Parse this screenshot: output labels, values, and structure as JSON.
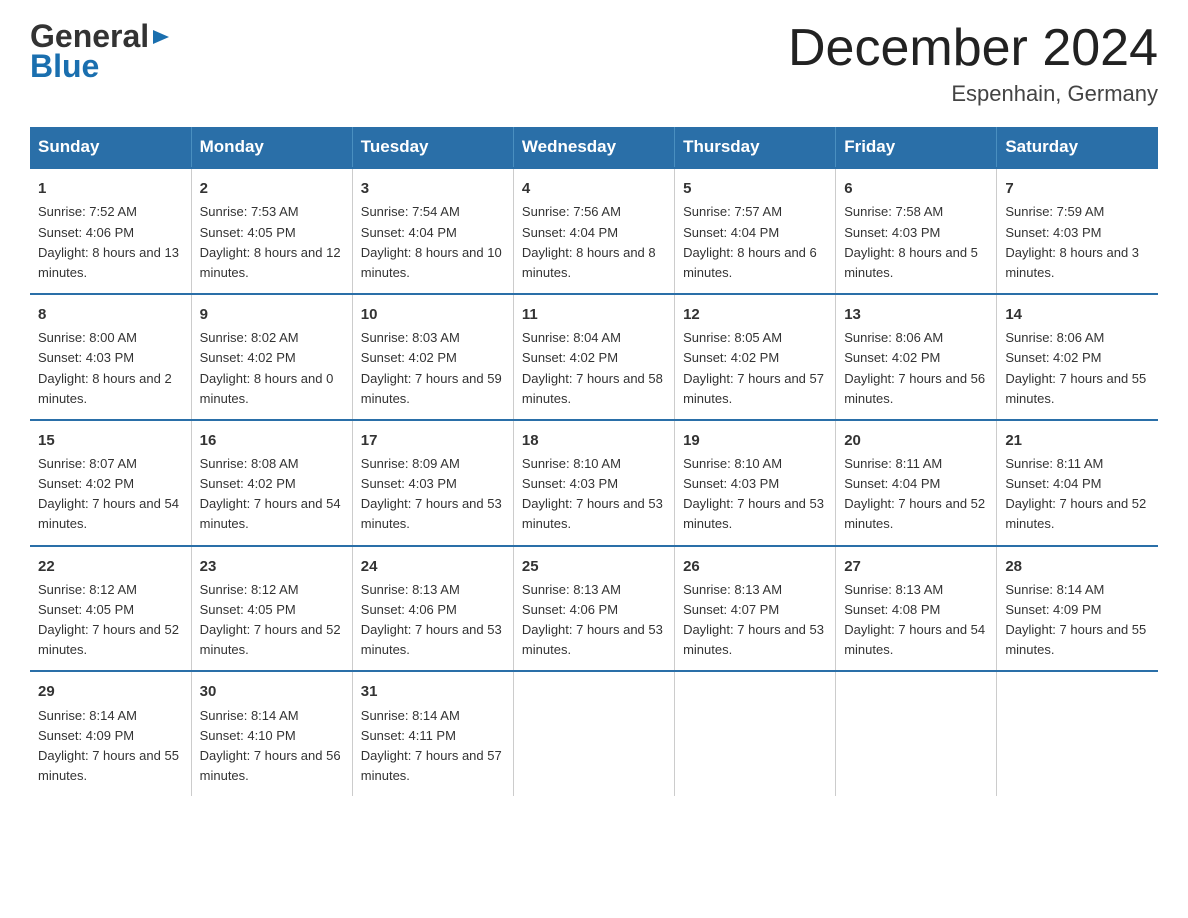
{
  "header": {
    "logo_general": "General",
    "logo_blue": "Blue",
    "month_title": "December 2024",
    "location": "Espenhain, Germany"
  },
  "days_of_week": [
    "Sunday",
    "Monday",
    "Tuesday",
    "Wednesday",
    "Thursday",
    "Friday",
    "Saturday"
  ],
  "weeks": [
    [
      {
        "num": "1",
        "sunrise": "7:52 AM",
        "sunset": "4:06 PM",
        "daylight": "8 hours and 13 minutes."
      },
      {
        "num": "2",
        "sunrise": "7:53 AM",
        "sunset": "4:05 PM",
        "daylight": "8 hours and 12 minutes."
      },
      {
        "num": "3",
        "sunrise": "7:54 AM",
        "sunset": "4:04 PM",
        "daylight": "8 hours and 10 minutes."
      },
      {
        "num": "4",
        "sunrise": "7:56 AM",
        "sunset": "4:04 PM",
        "daylight": "8 hours and 8 minutes."
      },
      {
        "num": "5",
        "sunrise": "7:57 AM",
        "sunset": "4:04 PM",
        "daylight": "8 hours and 6 minutes."
      },
      {
        "num": "6",
        "sunrise": "7:58 AM",
        "sunset": "4:03 PM",
        "daylight": "8 hours and 5 minutes."
      },
      {
        "num": "7",
        "sunrise": "7:59 AM",
        "sunset": "4:03 PM",
        "daylight": "8 hours and 3 minutes."
      }
    ],
    [
      {
        "num": "8",
        "sunrise": "8:00 AM",
        "sunset": "4:03 PM",
        "daylight": "8 hours and 2 minutes."
      },
      {
        "num": "9",
        "sunrise": "8:02 AM",
        "sunset": "4:02 PM",
        "daylight": "8 hours and 0 minutes."
      },
      {
        "num": "10",
        "sunrise": "8:03 AM",
        "sunset": "4:02 PM",
        "daylight": "7 hours and 59 minutes."
      },
      {
        "num": "11",
        "sunrise": "8:04 AM",
        "sunset": "4:02 PM",
        "daylight": "7 hours and 58 minutes."
      },
      {
        "num": "12",
        "sunrise": "8:05 AM",
        "sunset": "4:02 PM",
        "daylight": "7 hours and 57 minutes."
      },
      {
        "num": "13",
        "sunrise": "8:06 AM",
        "sunset": "4:02 PM",
        "daylight": "7 hours and 56 minutes."
      },
      {
        "num": "14",
        "sunrise": "8:06 AM",
        "sunset": "4:02 PM",
        "daylight": "7 hours and 55 minutes."
      }
    ],
    [
      {
        "num": "15",
        "sunrise": "8:07 AM",
        "sunset": "4:02 PM",
        "daylight": "7 hours and 54 minutes."
      },
      {
        "num": "16",
        "sunrise": "8:08 AM",
        "sunset": "4:02 PM",
        "daylight": "7 hours and 54 minutes."
      },
      {
        "num": "17",
        "sunrise": "8:09 AM",
        "sunset": "4:03 PM",
        "daylight": "7 hours and 53 minutes."
      },
      {
        "num": "18",
        "sunrise": "8:10 AM",
        "sunset": "4:03 PM",
        "daylight": "7 hours and 53 minutes."
      },
      {
        "num": "19",
        "sunrise": "8:10 AM",
        "sunset": "4:03 PM",
        "daylight": "7 hours and 53 minutes."
      },
      {
        "num": "20",
        "sunrise": "8:11 AM",
        "sunset": "4:04 PM",
        "daylight": "7 hours and 52 minutes."
      },
      {
        "num": "21",
        "sunrise": "8:11 AM",
        "sunset": "4:04 PM",
        "daylight": "7 hours and 52 minutes."
      }
    ],
    [
      {
        "num": "22",
        "sunrise": "8:12 AM",
        "sunset": "4:05 PM",
        "daylight": "7 hours and 52 minutes."
      },
      {
        "num": "23",
        "sunrise": "8:12 AM",
        "sunset": "4:05 PM",
        "daylight": "7 hours and 52 minutes."
      },
      {
        "num": "24",
        "sunrise": "8:13 AM",
        "sunset": "4:06 PM",
        "daylight": "7 hours and 53 minutes."
      },
      {
        "num": "25",
        "sunrise": "8:13 AM",
        "sunset": "4:06 PM",
        "daylight": "7 hours and 53 minutes."
      },
      {
        "num": "26",
        "sunrise": "8:13 AM",
        "sunset": "4:07 PM",
        "daylight": "7 hours and 53 minutes."
      },
      {
        "num": "27",
        "sunrise": "8:13 AM",
        "sunset": "4:08 PM",
        "daylight": "7 hours and 54 minutes."
      },
      {
        "num": "28",
        "sunrise": "8:14 AM",
        "sunset": "4:09 PM",
        "daylight": "7 hours and 55 minutes."
      }
    ],
    [
      {
        "num": "29",
        "sunrise": "8:14 AM",
        "sunset": "4:09 PM",
        "daylight": "7 hours and 55 minutes."
      },
      {
        "num": "30",
        "sunrise": "8:14 AM",
        "sunset": "4:10 PM",
        "daylight": "7 hours and 56 minutes."
      },
      {
        "num": "31",
        "sunrise": "8:14 AM",
        "sunset": "4:11 PM",
        "daylight": "7 hours and 57 minutes."
      },
      null,
      null,
      null,
      null
    ]
  ],
  "labels": {
    "sunrise_prefix": "Sunrise: ",
    "sunset_prefix": "Sunset: ",
    "daylight_prefix": "Daylight: "
  }
}
